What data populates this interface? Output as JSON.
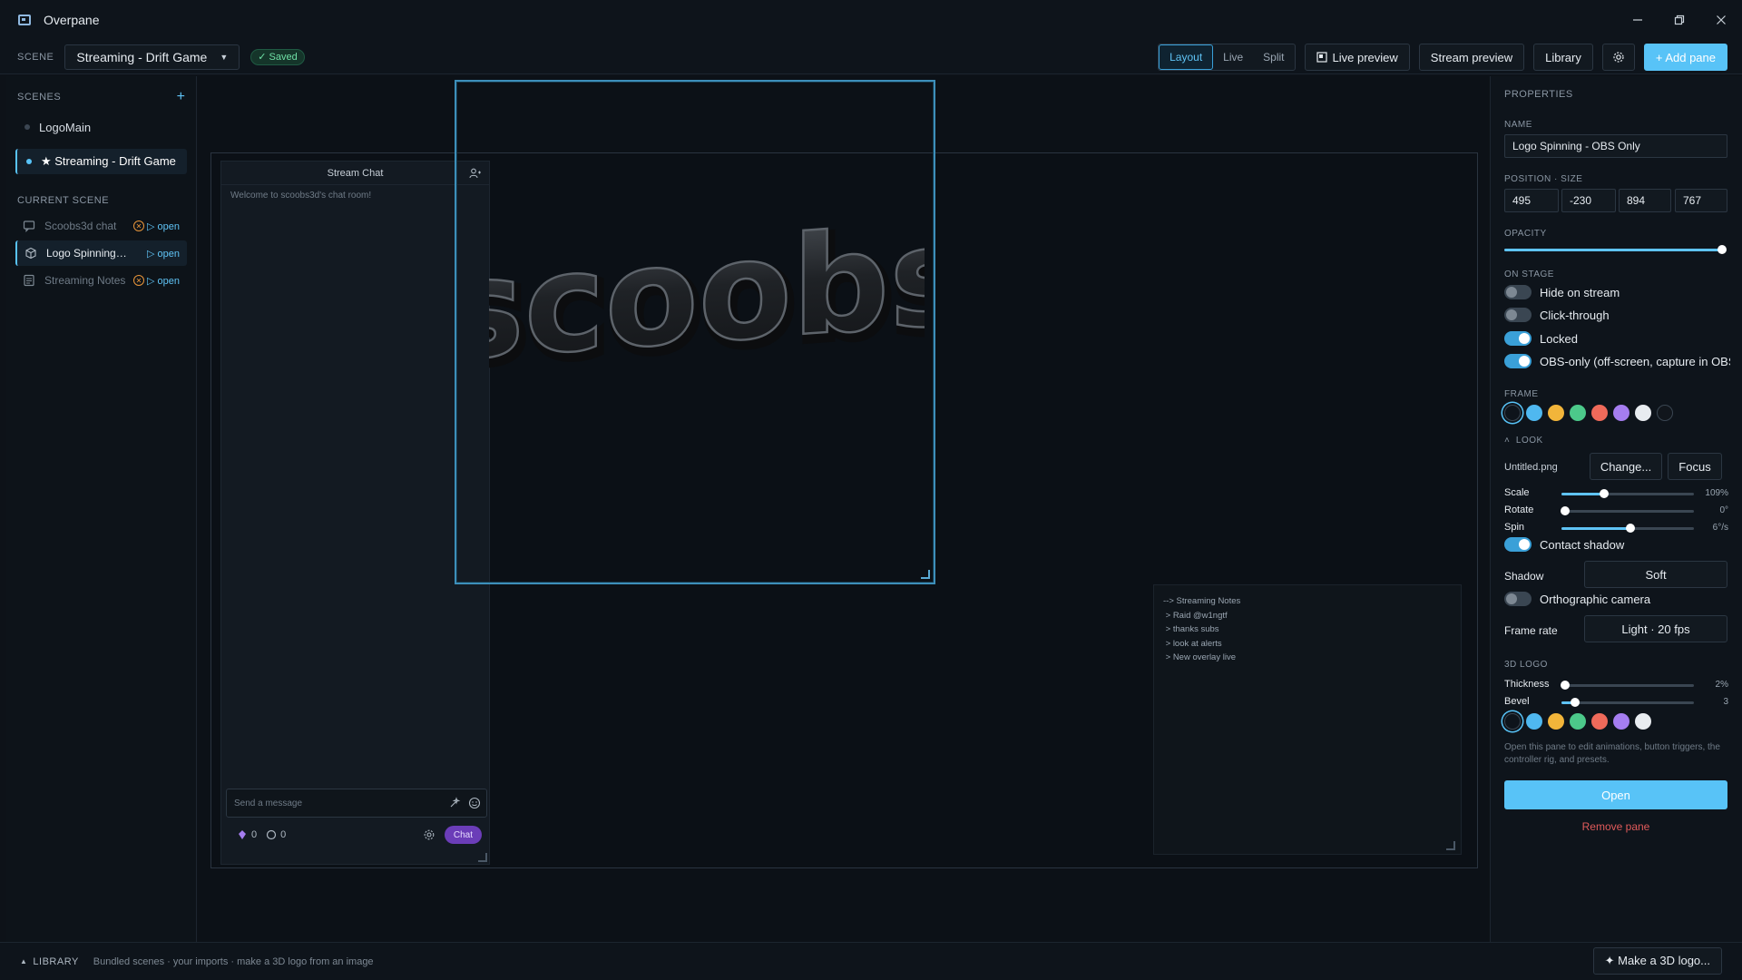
{
  "app": {
    "title": "Overpane"
  },
  "toolbar": {
    "scene_label": "SCENE",
    "scene_value": "Streaming - Drift Game",
    "saved": "✓ Saved",
    "modes": [
      "Layout",
      "Live",
      "Split"
    ],
    "active_mode": "Layout",
    "live_preview": "Live preview",
    "stream_preview": "Stream preview",
    "library": "Library",
    "add_pane": "+ Add pane"
  },
  "sidebar": {
    "scenes_label": "SCENES",
    "scenes": [
      {
        "label": "LogoMain",
        "active": false
      },
      {
        "label": "★ Streaming - Drift Game",
        "active": true
      }
    ],
    "current_label": "CURRENT SCENE",
    "current_items": [
      {
        "label": "Scoobs3d chat",
        "icon": "chat-icon",
        "warning": true,
        "open": "▷ open",
        "active": false
      },
      {
        "label": "Logo Spinning - OBS Only",
        "icon": "cube-icon",
        "warning": false,
        "open": "▷ open",
        "active": true
      },
      {
        "label": "Streaming Notes",
        "icon": "notes-icon",
        "warning": true,
        "open": "▷ open",
        "active": false
      }
    ]
  },
  "canvas": {
    "chat": {
      "title": "Stream Chat",
      "welcome": "Welcome to scoobs3d's chat room!",
      "placeholder": "Send a message",
      "count_a": "0",
      "count_b": "0",
      "chat_button": "Chat"
    },
    "notes": {
      "lines": [
        "--> Streaming Notes",
        " > Raid @w1ngtf",
        " > thanks subs",
        " > look at alerts",
        " > New overlay live"
      ]
    },
    "logo_text": "scoobs"
  },
  "properties": {
    "title": "PROPERTIES",
    "name_label": "NAME",
    "name_value": "Logo Spinning - OBS Only",
    "pos_label": "POSITION · SIZE",
    "pos": [
      "495",
      "-230",
      "894",
      "767"
    ],
    "opacity_label": "OPACITY",
    "opacity": 1.0,
    "on_stage_label": "ON STAGE",
    "toggles": [
      {
        "label": "Hide on stream",
        "on": false
      },
      {
        "label": "Click-through",
        "on": false
      },
      {
        "label": "Locked",
        "on": true
      },
      {
        "label": "OBS-only (off-screen, capture in OBS)",
        "on": true
      }
    ],
    "frame_label": "FRAME",
    "frame_colors": [
      "#0e141b",
      "#4fb8f0",
      "#f2b53a",
      "#4cc98a",
      "#ef6a5a",
      "#a57df0",
      "#e8ecf0",
      "#11161c"
    ],
    "look_label": "LOOK",
    "look_file": "Untitled.png",
    "change_button": "Change...",
    "focus_button": "Focus",
    "sliders": [
      {
        "label": "Scale",
        "value": "109%",
        "fraction": 0.32
      },
      {
        "label": "Rotate",
        "value": "0°",
        "fraction": 0.03
      },
      {
        "label": "Spin",
        "value": "6°/s",
        "fraction": 0.52
      }
    ],
    "contact_shadow": {
      "label": "Contact shadow",
      "on": true
    },
    "shadow_label": "Shadow",
    "shadow_value": "Soft",
    "ortho": {
      "label": "Orthographic camera",
      "on": false
    },
    "frame_rate_label": "Frame rate",
    "frame_rate_value": "Light · 20 fps",
    "logo3d_label": "3D LOGO",
    "logo_sliders": [
      {
        "label": "Thickness",
        "value": "2%",
        "fraction": 0.03
      },
      {
        "label": "Bevel",
        "value": "3",
        "fraction": 0.1
      }
    ],
    "logo_colors": [
      "#0e141b",
      "#4fb8f0",
      "#f2b53a",
      "#4cc98a",
      "#ef6a5a",
      "#a57df0",
      "#e8ecf0"
    ],
    "hint": "Open this pane to edit animations, button triggers, the controller rig, and presets.",
    "open_button": "Open",
    "remove_link": "Remove pane"
  },
  "footer": {
    "library_label": "LIBRARY",
    "subtitle": "Bundled scenes · your imports · make a 3D logo from an image",
    "make_logo": "✦ Make a 3D logo..."
  }
}
